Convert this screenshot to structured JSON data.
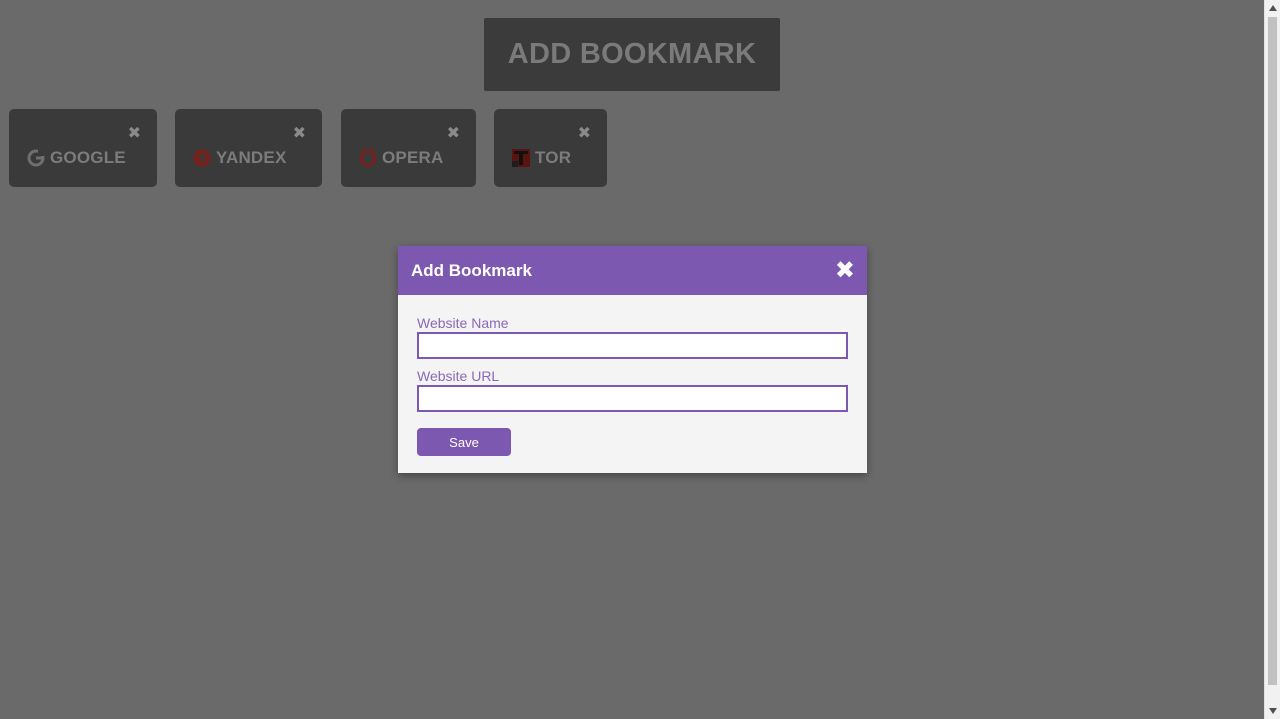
{
  "header": {
    "add_bookmark_label": "ADD BOOKMARK"
  },
  "bookmarks": [
    {
      "name": "GOOGLE",
      "icon": "google-icon",
      "close": "✖"
    },
    {
      "name": "YANDEX",
      "icon": "yandex-icon",
      "close": "✖"
    },
    {
      "name": "OPERA",
      "icon": "opera-icon",
      "close": "✖"
    },
    {
      "name": "TOR",
      "icon": "tor-icon",
      "close": "✖"
    }
  ],
  "modal": {
    "title": "Add Bookmark",
    "close": "✖",
    "name_label": "Website Name",
    "name_value": "",
    "url_label": "Website URL",
    "url_value": "",
    "save_label": "Save"
  },
  "colors": {
    "accent": "#7d58b0",
    "overlay": "#6a6a6a",
    "card": "#3a3a3a"
  },
  "scrollbar": {
    "up_icon": "scroll-up-arrow-icon",
    "down_icon": "scroll-down-arrow-icon"
  }
}
